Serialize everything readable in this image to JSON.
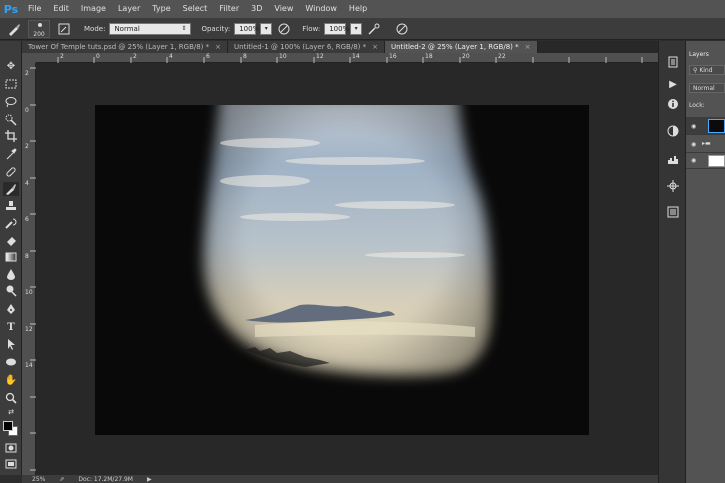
{
  "app": {
    "logo": "Ps"
  },
  "menu": [
    "File",
    "Edit",
    "Image",
    "Layer",
    "Type",
    "Select",
    "Filter",
    "3D",
    "View",
    "Window",
    "Help"
  ],
  "options": {
    "brush_size": "200",
    "mode_label": "Mode:",
    "mode_value": "Normal",
    "opacity_label": "Opacity:",
    "opacity_value": "100%",
    "flow_label": "Flow:",
    "flow_value": "100%"
  },
  "tabs": [
    {
      "label": "Tower Of Temple tuts.psd @ 25% (Layer 1, RGB/8) *",
      "active": false
    },
    {
      "label": "Untitled-1 @ 100% (Layer 6, RGB/8) *",
      "active": false
    },
    {
      "label": "Untitled-2 @ 25% (Layer 1, RGB/8) *",
      "active": true
    }
  ],
  "ruler": {
    "top": [
      "2",
      "0",
      "2",
      "4",
      "6",
      "8",
      "10",
      "12",
      "14",
      "16",
      "18",
      "20",
      "22"
    ],
    "left": [
      "2",
      "0",
      "2",
      "4",
      "6",
      "8",
      "10",
      "12",
      "14"
    ]
  },
  "status": {
    "zoom": "25%",
    "doc": "Doc: 17.2M/27.9M"
  },
  "panel": {
    "tab": "Layers",
    "kind": "Kind",
    "blend": "Normal",
    "lock": "Lock:"
  },
  "colors": {
    "foreground": "#000000",
    "background": "#ffffff",
    "accent": "#2fa3f5"
  }
}
